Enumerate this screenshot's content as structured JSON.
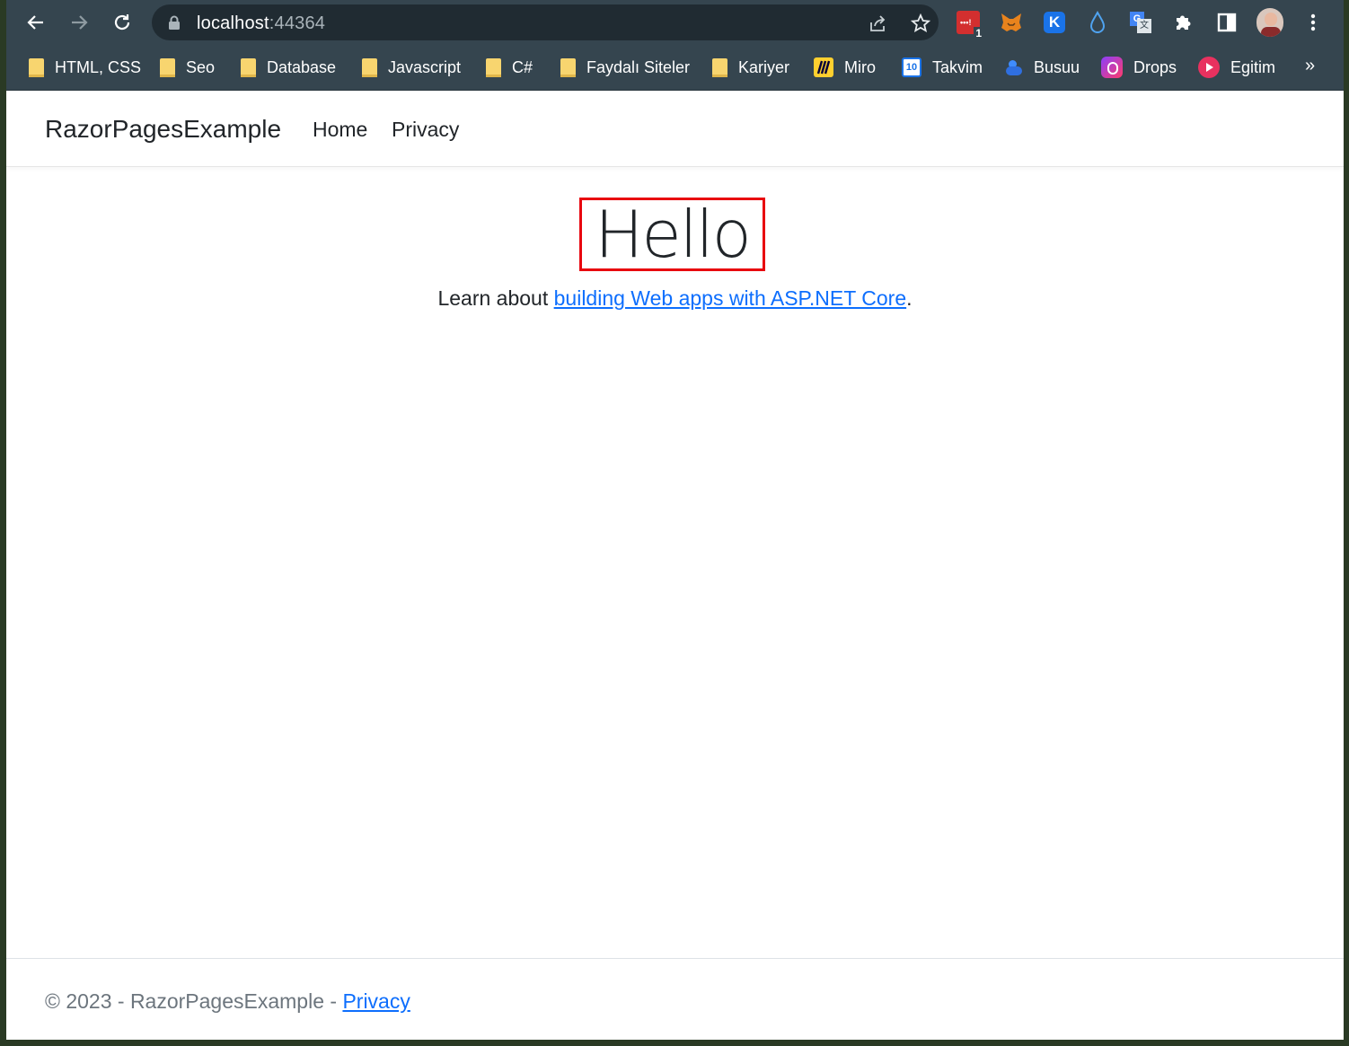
{
  "browser": {
    "url_host": "localhost",
    "url_port": ":44364",
    "extension_badge": "1",
    "bookmarks": [
      {
        "label": "HTML, CSS",
        "icon": "folder-icon"
      },
      {
        "label": "Seo",
        "icon": "folder-icon"
      },
      {
        "label": "Database",
        "icon": "folder-icon"
      },
      {
        "label": "Javascript",
        "icon": "folder-icon"
      },
      {
        "label": "C#",
        "icon": "folder-icon"
      },
      {
        "label": "Faydalı Siteler",
        "icon": "folder-icon"
      },
      {
        "label": "Kariyer",
        "icon": "folder-icon"
      },
      {
        "label": "Miro",
        "icon": "miro-icon"
      },
      {
        "label": "Takvim",
        "icon": "calendar-icon"
      },
      {
        "label": "Busuu",
        "icon": "busuu-icon"
      },
      {
        "label": "Drops",
        "icon": "drops-icon"
      },
      {
        "label": "Egitim",
        "icon": "egitim-icon"
      }
    ],
    "calendar_day": "10",
    "more": "»"
  },
  "site": {
    "brand": "RazorPagesExample",
    "nav": {
      "home": "Home",
      "privacy": "Privacy"
    }
  },
  "main": {
    "heading": "Hello",
    "learn_prefix": "Learn about ",
    "learn_link": "building Web apps with ASP.NET Core",
    "learn_suffix": "."
  },
  "footer": {
    "text": "© 2023 - RazorPagesExample - ",
    "privacy": "Privacy"
  },
  "colors": {
    "chrome_bg": "#35454f",
    "highlight_border": "#e8060f",
    "link": "#0d6efd"
  }
}
